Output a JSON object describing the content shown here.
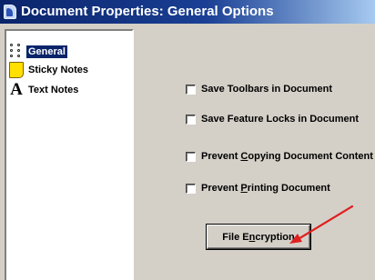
{
  "window": {
    "title": "Document Properties: General Options"
  },
  "sidebar": {
    "items": [
      {
        "label": "General",
        "icon": "general-options-icon",
        "selected": true
      },
      {
        "label": "Sticky Notes",
        "icon": "sticky-note-icon",
        "selected": false
      },
      {
        "label": "Text Notes",
        "icon": "text-letter-icon",
        "selected": false
      }
    ]
  },
  "options": {
    "checkboxes": [
      {
        "label": "Save Toolbars in Document",
        "checked": false
      },
      {
        "label_pre": "Save Feature Locks in Document",
        "checked": false
      },
      {
        "label_pre": "Prevent ",
        "label_u": "C",
        "label_post": "opying Document Content",
        "checked": false
      },
      {
        "label_pre": "Prevent ",
        "label_u": "P",
        "label_post": "rinting Document",
        "checked": false
      }
    ],
    "encryption_button": {
      "label_pre": "File E",
      "label_u": "n",
      "label_post": "cryption"
    }
  },
  "colors": {
    "titlebar": "#0a246a",
    "selection": "#0a246a",
    "annotation_arrow": "#e02020",
    "sticky_note": "#ffe000"
  }
}
